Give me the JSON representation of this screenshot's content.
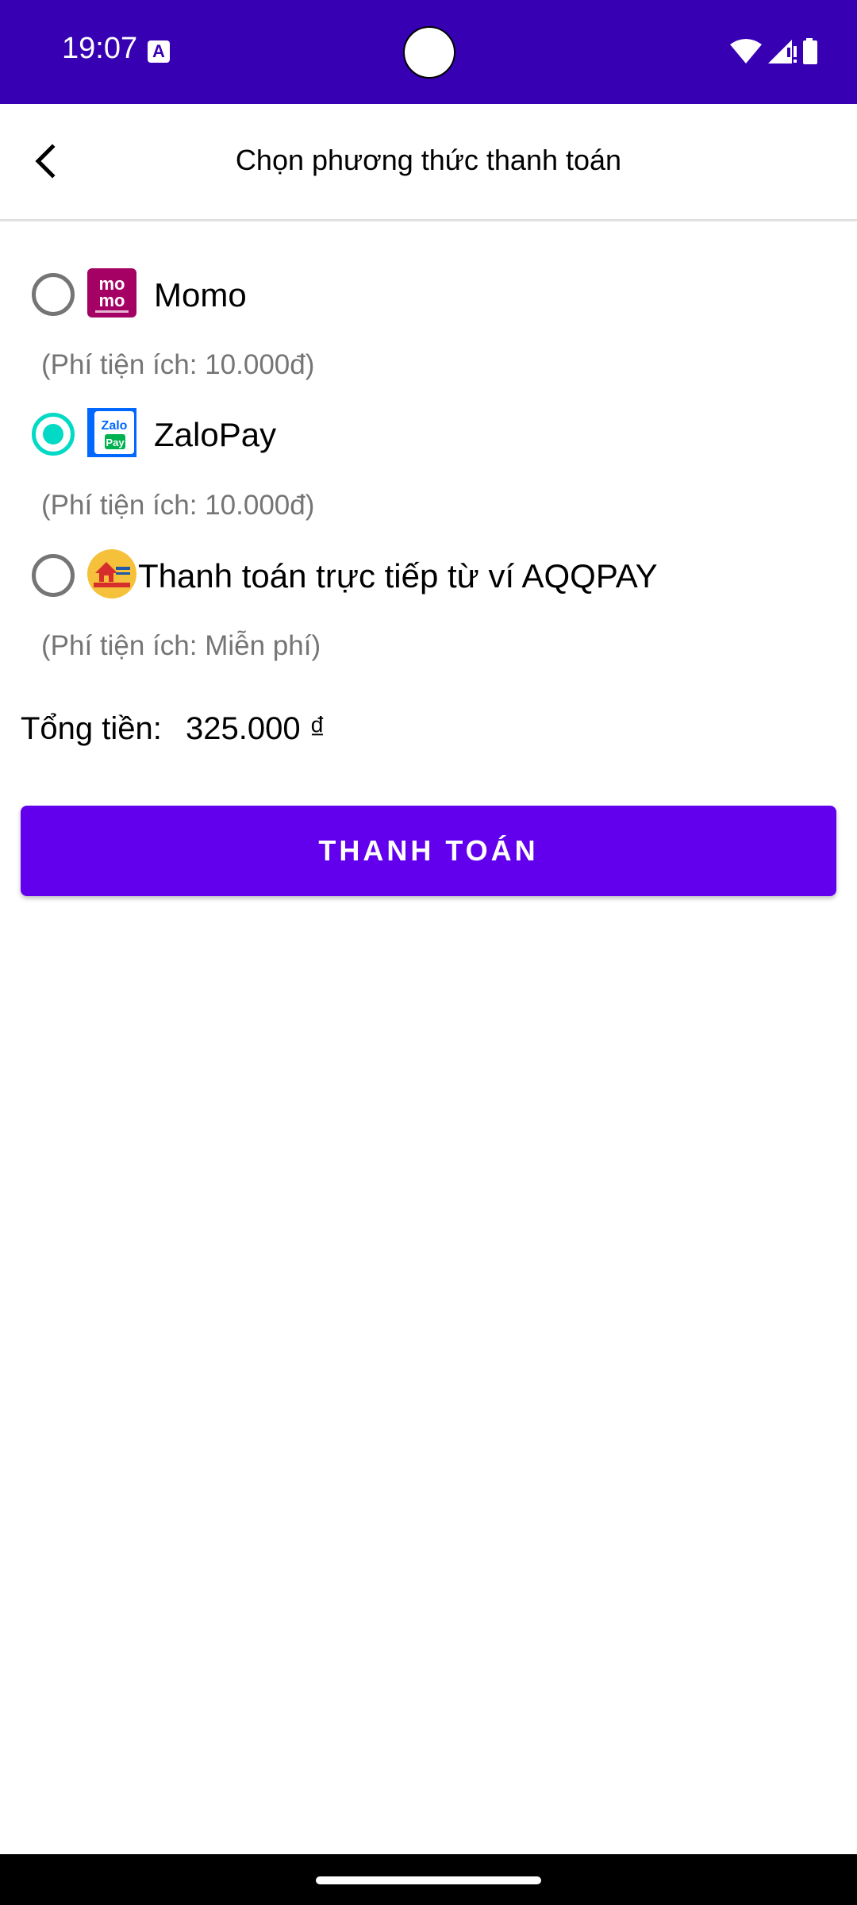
{
  "status_bar": {
    "time": "19:07",
    "notification_icon": "A",
    "background_color": "#3700b3",
    "icons": [
      "wifi-icon",
      "signal-icon",
      "battery-icon"
    ]
  },
  "app_bar": {
    "title": "Chọn phương thức thanh toán",
    "back_icon": "chevron-left-icon"
  },
  "payment_methods": [
    {
      "label": "Momo",
      "fee": "(Phí tiện ích: 10.000đ)",
      "selected": false,
      "logo": "momo-logo-icon",
      "logo_text_top": "mo",
      "logo_text_bottom": "mo"
    },
    {
      "label": "ZaloPay",
      "fee": "(Phí tiện ích: 10.000đ)",
      "selected": true,
      "logo": "zalopay-logo-icon",
      "logo_text_top": "Zalo",
      "logo_text_bottom": "Pay"
    },
    {
      "label": "Thanh toán trực tiếp từ ví AQQPAY",
      "fee": "(Phí tiện ích: Miễn phí)",
      "selected": false,
      "logo": "aqqpay-logo-icon"
    }
  ],
  "total": {
    "label": "Tổng tiền:",
    "value": "325.000 ₫"
  },
  "pay_button": {
    "label": "THANH TOÁN"
  },
  "colors": {
    "primary": "#6200ee",
    "primary_dark": "#3700b3",
    "accent": "#03dac5"
  }
}
